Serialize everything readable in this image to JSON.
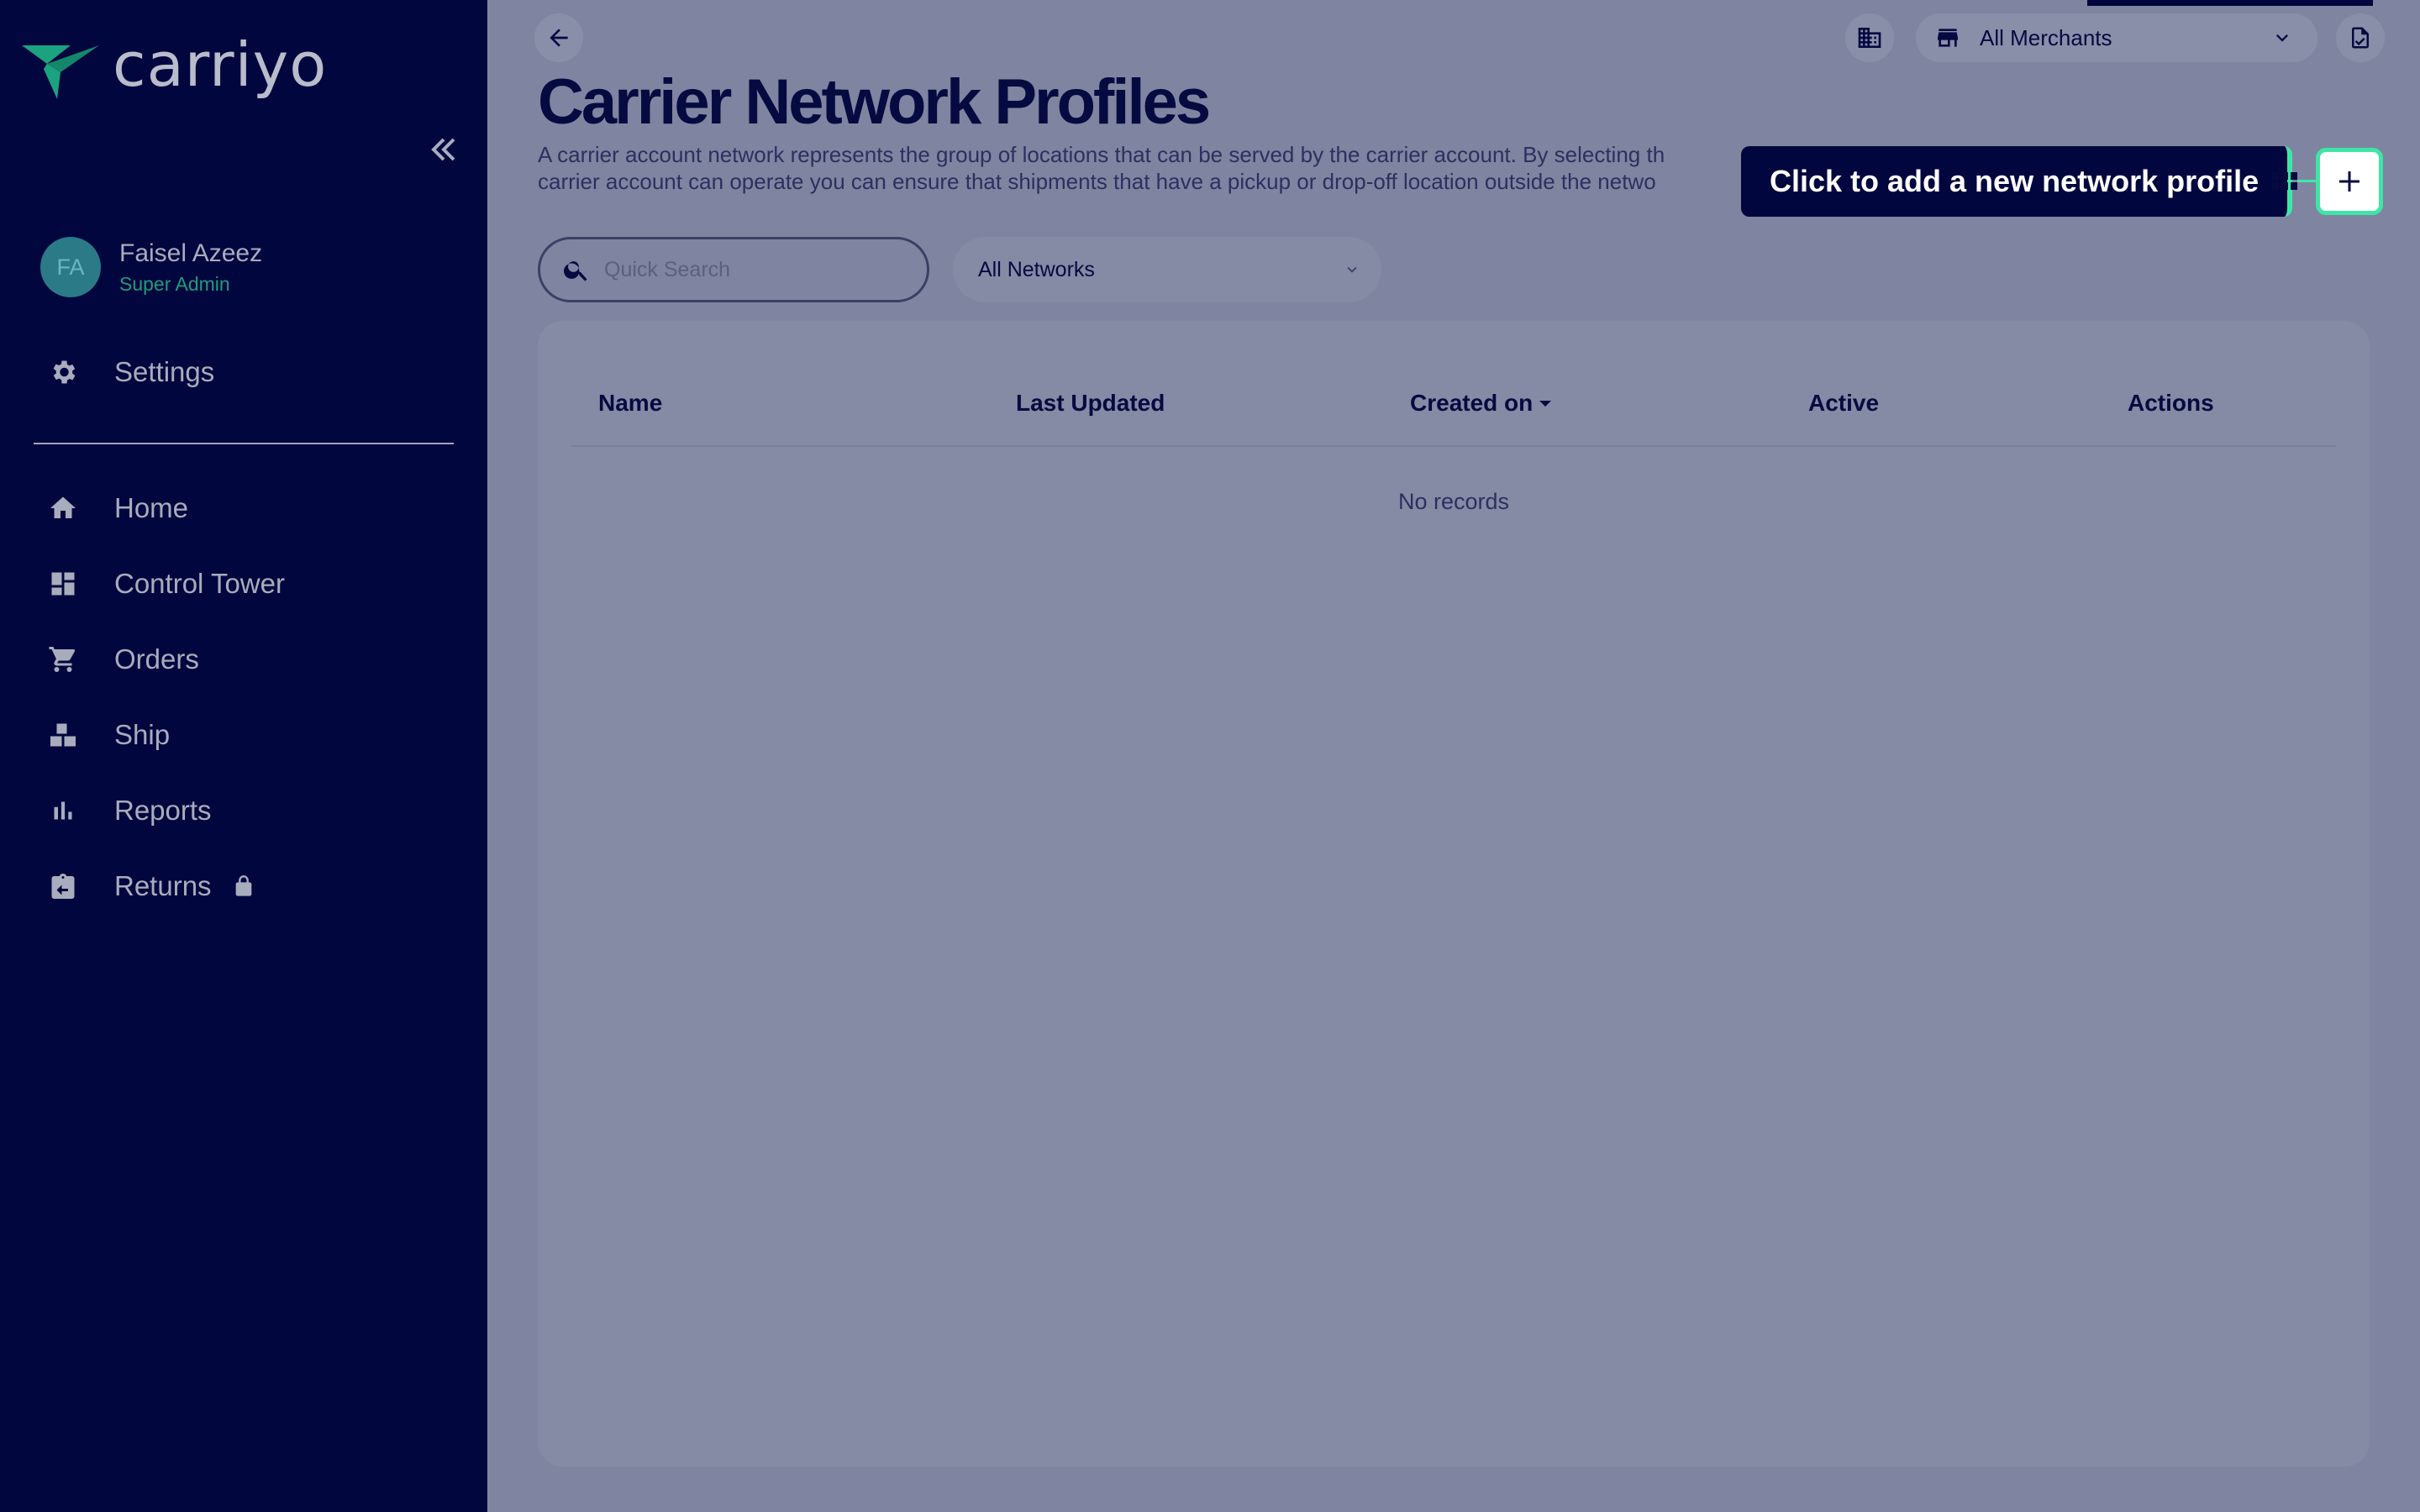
{
  "brand": {
    "name": "carriyo"
  },
  "user": {
    "initials": "FA",
    "name": "Faisel Azeez",
    "role": "Super Admin"
  },
  "sidebar": {
    "settings": {
      "label": "Settings",
      "icon": "gear-icon"
    },
    "items": [
      {
        "label": "Home",
        "icon": "home-icon"
      },
      {
        "label": "Control Tower",
        "icon": "dashboard-icon"
      },
      {
        "label": "Orders",
        "icon": "cart-icon"
      },
      {
        "label": "Ship",
        "icon": "boxes-icon"
      },
      {
        "label": "Reports",
        "icon": "bar-chart-icon"
      },
      {
        "label": "Returns",
        "icon": "return-box-icon",
        "locked": true
      }
    ]
  },
  "topbar": {
    "merchant_select": "All Merchants"
  },
  "page": {
    "title": "Carrier Network Profiles",
    "description_line1": "A carrier account network represents the group of locations that can be served by the carrier account. By selecting th",
    "description_line2": "carrier account can operate you can ensure that shipments that have a pickup or drop-off location outside the netwo"
  },
  "tooltip": {
    "text": "Click to add a new network profile"
  },
  "filters": {
    "search_placeholder": "Quick Search",
    "network_select": "All Networks"
  },
  "table": {
    "columns": [
      "Name",
      "Last Updated",
      "Created on",
      "Active",
      "Actions"
    ],
    "sorted_column": "Created on",
    "rows": [],
    "empty_text": "No records"
  },
  "colors": {
    "sidebar_bg": "#02063e",
    "accent_green": "#3ee6a6",
    "overlay_bg": "#7f84a0",
    "heading": "#050a40"
  }
}
